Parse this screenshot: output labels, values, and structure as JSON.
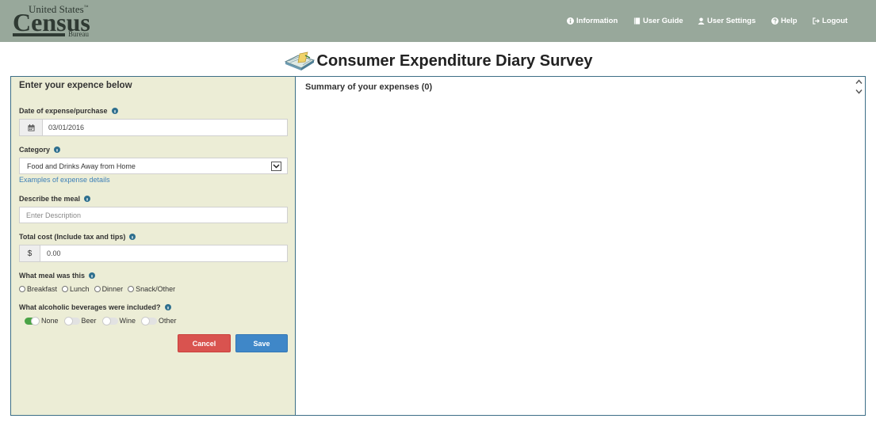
{
  "header": {
    "logo": {
      "line1": "United States",
      "tm": "™",
      "line2": "Census",
      "line3": "Bureau"
    },
    "nav": [
      {
        "label": "Information",
        "icon": "info-circle-icon"
      },
      {
        "label": "User Guide",
        "icon": "book-icon"
      },
      {
        "label": "User Settings",
        "icon": "user-icon"
      },
      {
        "label": "Help",
        "icon": "question-circle-icon"
      },
      {
        "label": "Logout",
        "icon": "sign-out-icon"
      }
    ]
  },
  "page": {
    "title": "Consumer Expenditure Diary Survey",
    "title_icon": "diary-book-icon"
  },
  "form": {
    "heading": "Enter your expence below",
    "date_label": "Date of expense/purchase",
    "date_value": "03/01/2016",
    "category_label": "Category",
    "category_value": "Food and Drinks Away from Home",
    "examples_link": "Examples of expense details",
    "describe_label": "Describe the meal",
    "describe_placeholder": "Enter Description",
    "cost_label": "Total cost (Include tax and tips)",
    "cost_prefix": "$",
    "cost_value": "0.00",
    "meal_label": "What meal was this",
    "meal_options": [
      "Breakfast",
      "Lunch",
      "Dinner",
      "Snack/Other"
    ],
    "alcohol_label": "What alcoholic beverages were included?",
    "alcohol_options": [
      {
        "label": "None",
        "on": true
      },
      {
        "label": "Beer",
        "on": false
      },
      {
        "label": "Wine",
        "on": false
      },
      {
        "label": "Other",
        "on": false
      }
    ],
    "cancel_label": "Cancel",
    "save_label": "Save"
  },
  "summary": {
    "title": "Summary of your expenses (0)"
  },
  "colors": {
    "header_bg": "#98a89b",
    "panel_bg": "#ecedd6",
    "panel_border": "#3c6e86",
    "cancel": "#d9534f",
    "save": "#3f87c8",
    "toggle_on": "#4aa346",
    "link": "#3d7fb8"
  }
}
